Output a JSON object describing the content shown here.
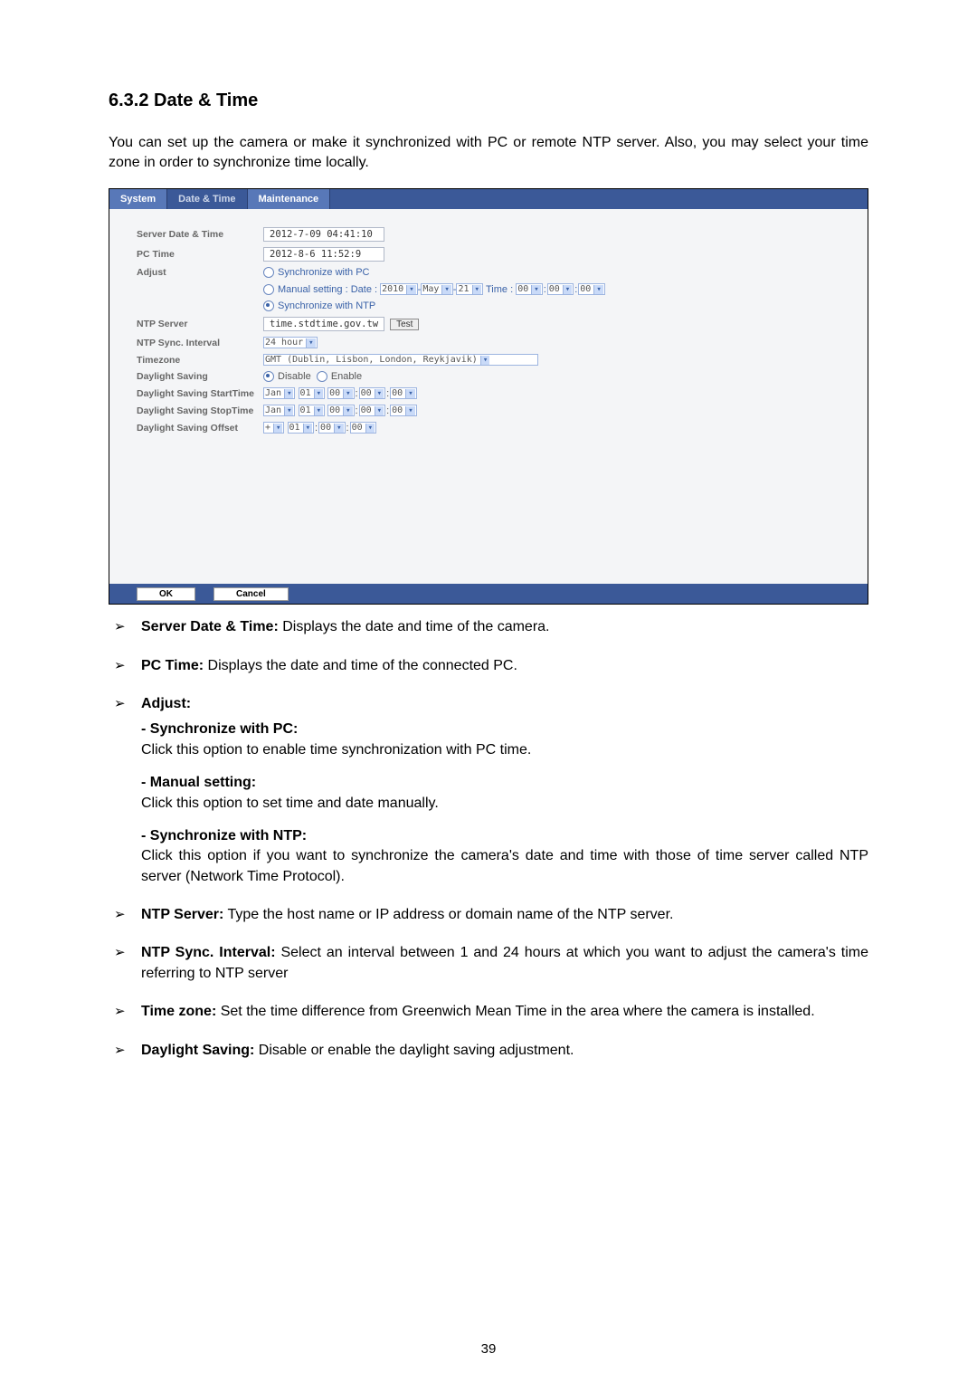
{
  "heading": "6.3.2  Date & Time",
  "intro": "You can set up the camera or make it synchronized with PC or remote NTP server. Also, you may select your time zone in order to synchronize time locally.",
  "tabs": {
    "system": "System",
    "date_time": "Date & Time",
    "maintenance": "Maintenance"
  },
  "form": {
    "server_dt_label": "Server Date & Time",
    "server_dt_value": "2012-7-09 04:41:10",
    "pc_time_label": "PC Time",
    "pc_time_value": "2012-8-6 11:52:9",
    "adjust_label": "Adjust",
    "sync_pc": "Synchronize with PC",
    "manual_prefix": "Manual setting : Date :",
    "manual_year": "2010",
    "manual_month": "May",
    "manual_day": "21",
    "manual_time_label": "Time :",
    "manual_h": "00",
    "manual_m": "00",
    "manual_s": "00",
    "sync_ntp": "Synchronize with NTP",
    "ntp_server_label": "NTP Server",
    "ntp_server_value": "time.stdtime.gov.tw",
    "test_label": "Test",
    "ntp_interval_label": "NTP Sync. Interval",
    "ntp_interval_value": "24 hour",
    "tz_label": "Timezone",
    "tz_value": "GMT (Dublin, Lisbon, London, Reykjavik)",
    "ds_label": "Daylight Saving",
    "ds_disable": "Disable",
    "ds_enable": "Enable",
    "ds_start_label": "Daylight Saving StartTime",
    "ds_stop_label": "Daylight Saving StopTime",
    "ds_month": "Jan",
    "ds_d1": "01",
    "ds_v00": "00",
    "ds_offset_label": "Daylight Saving Offset",
    "ds_sign": "+",
    "ds_off1": "01",
    "ds_off2": "00",
    "ds_off3": "00"
  },
  "footer": {
    "ok": "OK",
    "cancel": "Cancel"
  },
  "bullets": {
    "server_dt_b": "Server Date & Time:",
    "server_dt_t": " Displays the date and time of the camera.",
    "pc_b": "PC Time:",
    "pc_t": " Displays the date and time of the connected PC.",
    "adjust_b": "Adjust:",
    "sub_pc_b": "- Synchronize with PC:",
    "sub_pc_t": "Click this option to enable time synchronization with PC time.",
    "sub_man_b": "- Manual setting:",
    "sub_man_t": "Click this option to set time and date manually.",
    "sub_ntp_b": "- Synchronize with NTP:",
    "sub_ntp_t": "Click this option if you want to synchronize the camera's date and time with those of time server called NTP server (Network Time Protocol).",
    "ntp_server_b": "NTP Server:",
    "ntp_server_t": " Type the host name or IP address or domain name of the NTP server.",
    "ntp_int_b": "NTP Sync. Interval:",
    "ntp_int_t": " Select an interval between 1 and 24 hours at which you want to adjust the camera's time referring to NTP server",
    "tz_b": "Time zone:",
    "tz_t": " Set the time difference from Greenwich Mean Time in the area where the camera is installed.",
    "ds_b": "Daylight Saving:",
    "ds_t": " Disable or enable the daylight saving adjustment."
  },
  "page_number": "39"
}
